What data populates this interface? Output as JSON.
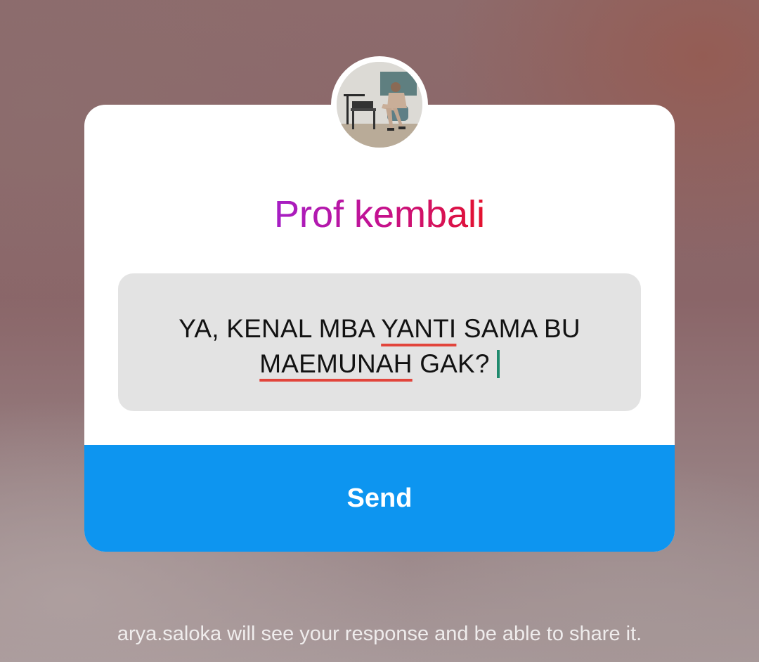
{
  "question_sticker": {
    "avatar_alt": "profile photo",
    "title": "Prof kembali",
    "answer": {
      "segment_1": "YA, KENAL MBA ",
      "word_1": "YANTI",
      "segment_2": " SAMA BU",
      "word_2": "MAEMUNAH",
      "segment_3": " GAK?"
    },
    "send_label": "Send"
  },
  "footer": {
    "note": "arya.saloka will see your response and be able to share it."
  },
  "colors": {
    "send_button": "#0d95f0",
    "title_gradient_start": "#a51fc6",
    "title_gradient_end": "#e4122c",
    "spellcheck_underline": "#e2453c",
    "caret": "#1f8a6e"
  }
}
